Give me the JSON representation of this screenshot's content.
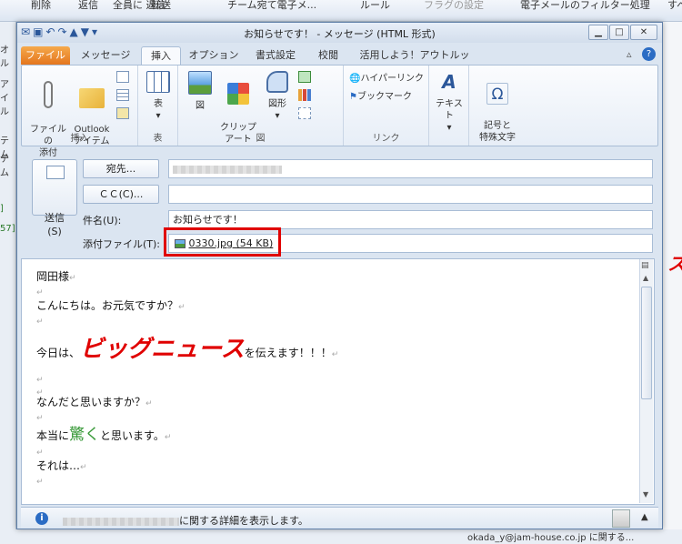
{
  "background_window": {
    "toolbar_items": [
      "削除",
      "返信",
      "全員に\n返信",
      "転送",
      "チーム宛て電子メ...",
      "ルール",
      "フラグの設定",
      "電子メールのフィルター処理",
      "すべて"
    ],
    "left_fragments": [
      "オル",
      "アイル",
      "テム",
      "テム",
      "]",
      "57]"
    ],
    "status_text": "okada_y@jam-house.co.jp に関する..."
  },
  "window": {
    "title": "お知らせです！ - メッセージ (HTML 形式)",
    "tabs": [
      "ファイル",
      "メッセージ",
      "挿入",
      "オプション",
      "書式設定",
      "校閲",
      "活用しよう！アウトルック"
    ],
    "active_tab": "挿入"
  },
  "ribbon": {
    "groups": [
      {
        "label": "挿入",
        "items": [
          "ファイルの\n添付",
          "Outlook\nアイテム"
        ]
      },
      {
        "label": "表",
        "items": [
          "表"
        ]
      },
      {
        "label": "図",
        "items": [
          "図",
          "クリップ\nアート",
          "図形"
        ]
      },
      {
        "label": "リンク",
        "items": [
          "ハイパーリンク",
          "ブックマーク"
        ]
      },
      {
        "label": "",
        "items": [
          "テキスト"
        ]
      },
      {
        "label": "",
        "items": [
          "記号と\n特殊文字"
        ]
      }
    ]
  },
  "compose": {
    "send_label": "送信\n(S)",
    "to_button": "宛先...",
    "cc_button": "ＣＣ(C)...",
    "subject_label": "件名(U):",
    "subject_value": "お知らせです！",
    "attachment_label": "添付ファイル(T):",
    "attachment": "0330.jpg (54 KB)"
  },
  "body": {
    "lines": [
      {
        "text": "岡田様"
      },
      {
        "text": ""
      },
      {
        "text": "こんにちは。お元気ですか？"
      },
      {
        "text": ""
      },
      {
        "pre": "今日は、",
        "big": "ビッグニュース",
        "post": "を伝えます！！！"
      },
      {
        "text": ""
      },
      {
        "text": ""
      },
      {
        "text": "なんだと思いますか？"
      },
      {
        "text": ""
      },
      {
        "pre": "本当に",
        "green": "驚く",
        "post": "と思います。"
      },
      {
        "text": ""
      },
      {
        "text": "それは…"
      }
    ],
    "big_color": "#e00000",
    "green_color": "#3a9a3a"
  },
  "status_bar": {
    "text": "に関する詳細を表示します。"
  }
}
